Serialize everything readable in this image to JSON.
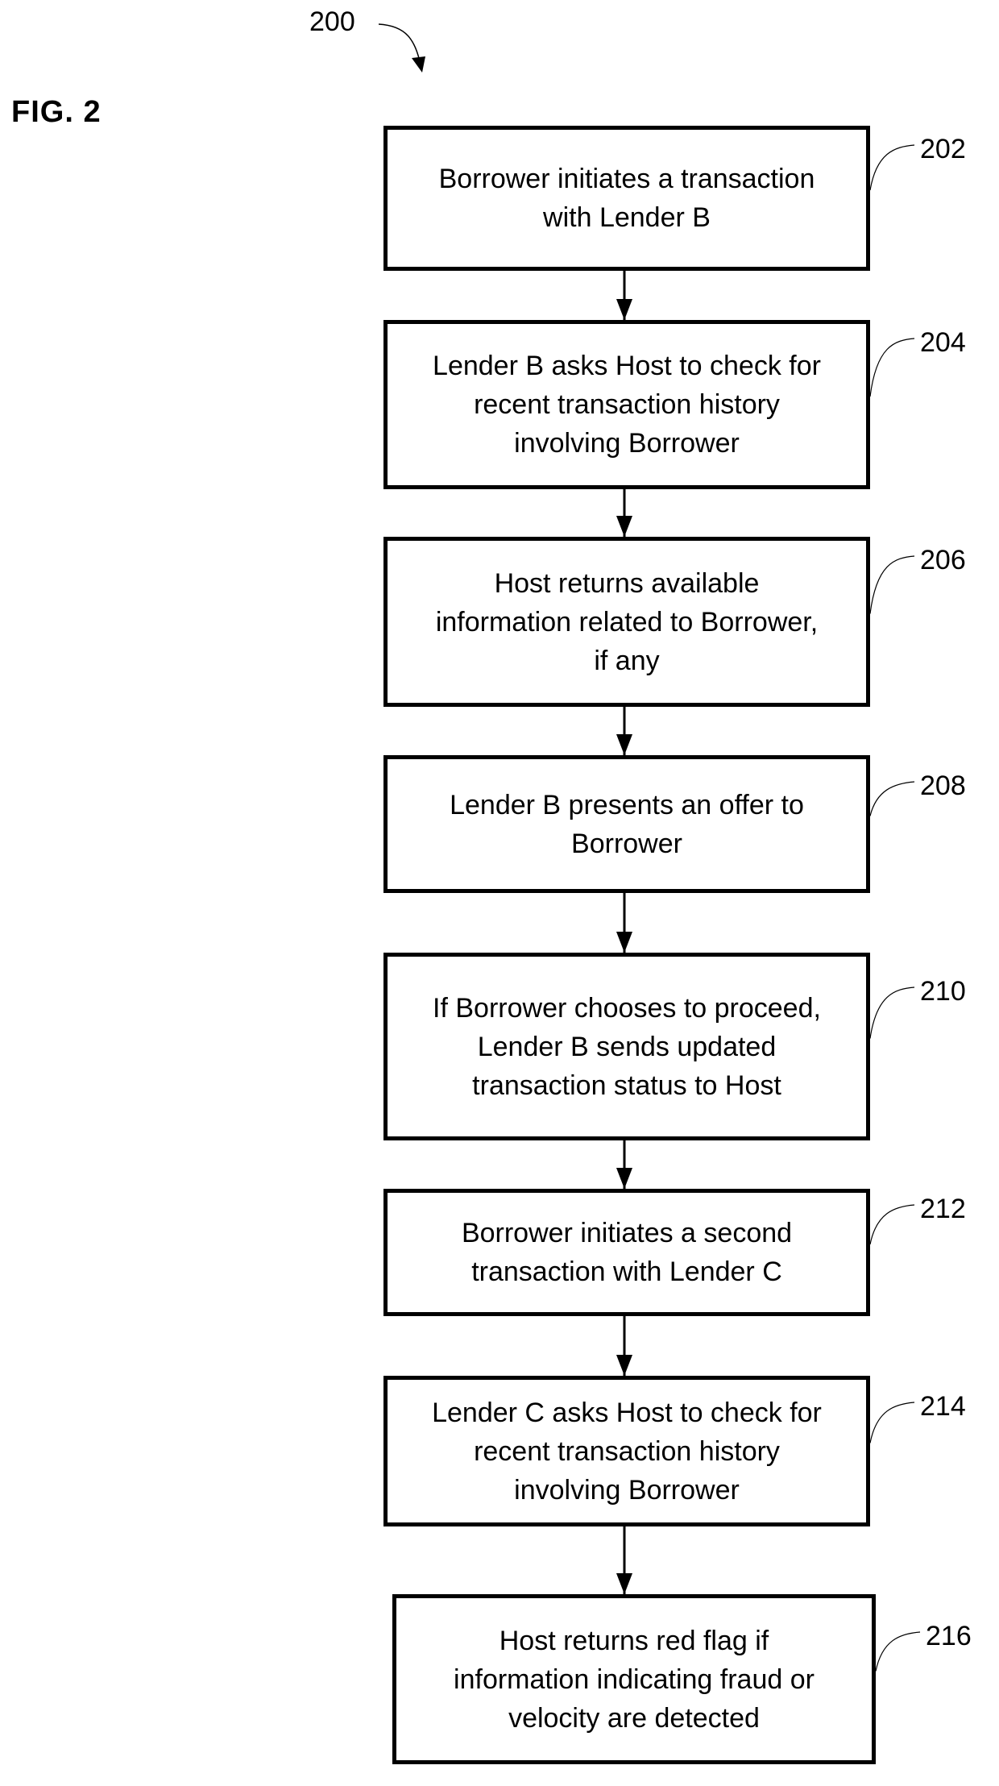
{
  "figure": {
    "label": "FIG. 2",
    "reference_number": "200"
  },
  "steps": [
    {
      "id": "202",
      "text": "Borrower initiates a transaction\nwith Lender B"
    },
    {
      "id": "204",
      "text": "Lender B asks Host to check for\nrecent transaction history\ninvolving Borrower"
    },
    {
      "id": "206",
      "text": "Host returns available\ninformation related to Borrower,\nif any"
    },
    {
      "id": "208",
      "text": "Lender B presents an offer to\nBorrower"
    },
    {
      "id": "210",
      "text": "If Borrower chooses to proceed,\nLender B sends updated\ntransaction status to Host"
    },
    {
      "id": "212",
      "text": "Borrower initiates a second\ntransaction with Lender C"
    },
    {
      "id": "214",
      "text": "Lender C asks Host to check for\nrecent transaction history\ninvolving Borrower"
    },
    {
      "id": "216",
      "text": "Host returns red flag if\ninformation indicating fraud or\nvelocity are detected"
    }
  ]
}
